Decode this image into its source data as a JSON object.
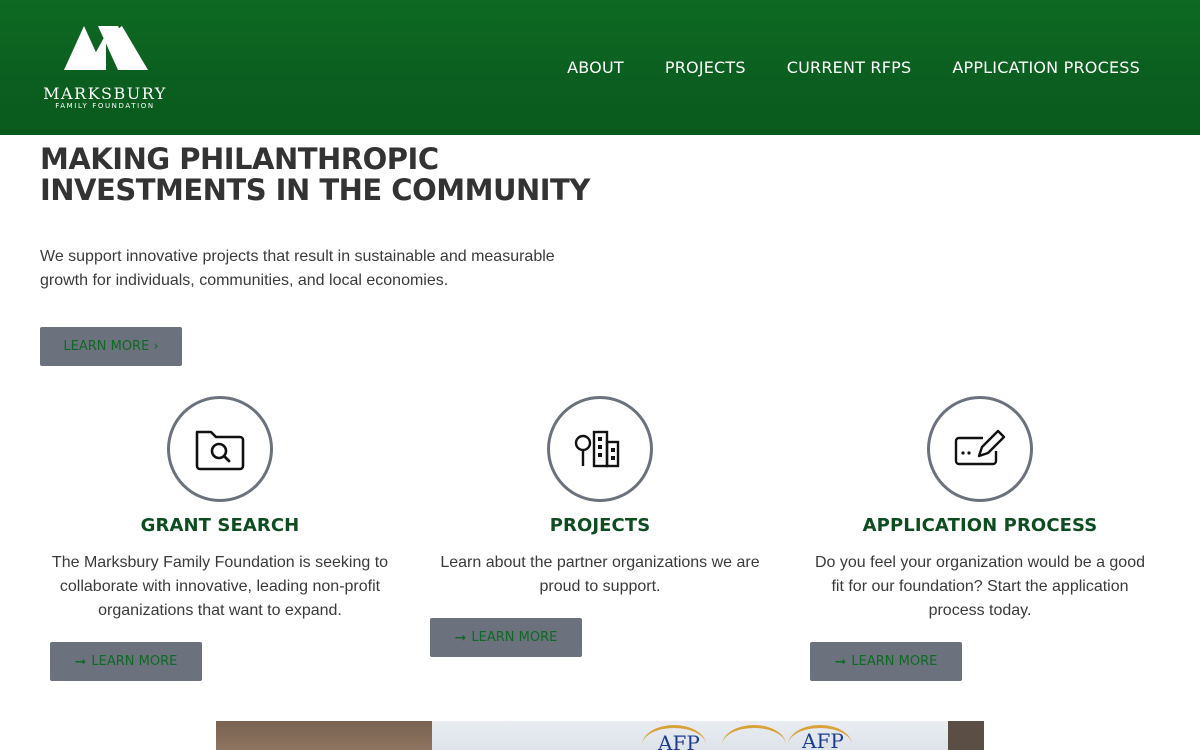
{
  "header": {
    "logo_name": "MARKSBURY",
    "logo_sub": "FAMILY FOUNDATION",
    "nav": [
      "ABOUT",
      "PROJECTS",
      "CURRENT RFPS",
      "APPLICATION PROCESS"
    ]
  },
  "hero": {
    "title_line1": "MAKING PHILANTHROPIC",
    "title_line2": "INVESTMENTS IN THE COMMUNITY",
    "text": "We support innovative projects that result in sustainable and measurable growth for individuals, communities, and local economies.",
    "button": "LEARN MORE ›"
  },
  "cards": [
    {
      "icon": "folder-search-icon",
      "title": "GRANT SEARCH",
      "text": "The Marksbury Family Foundation is seeking to collaborate with innovative, leading non-profit organizations that want to expand.",
      "button": "LEARN MORE"
    },
    {
      "icon": "city-tree-icon",
      "title": "PROJECTS",
      "text": "Learn about the partner organizations we are proud to support.",
      "button": "LEARN MORE"
    },
    {
      "icon": "sign-pen-icon",
      "title": "APPLICATION PROCESS",
      "text": "Do you feel your organization would be a good fit for our foundation? Start the application process today.",
      "button": "LEARN MORE"
    }
  ],
  "photo": {
    "banner_text_1": "AFP",
    "banner_text_2": "AFP"
  },
  "colors": {
    "header_green": "#0b5e1f",
    "heading_green": "#0e4d1f",
    "button_gray": "#6b727e",
    "button_text": "#0e6a22"
  }
}
